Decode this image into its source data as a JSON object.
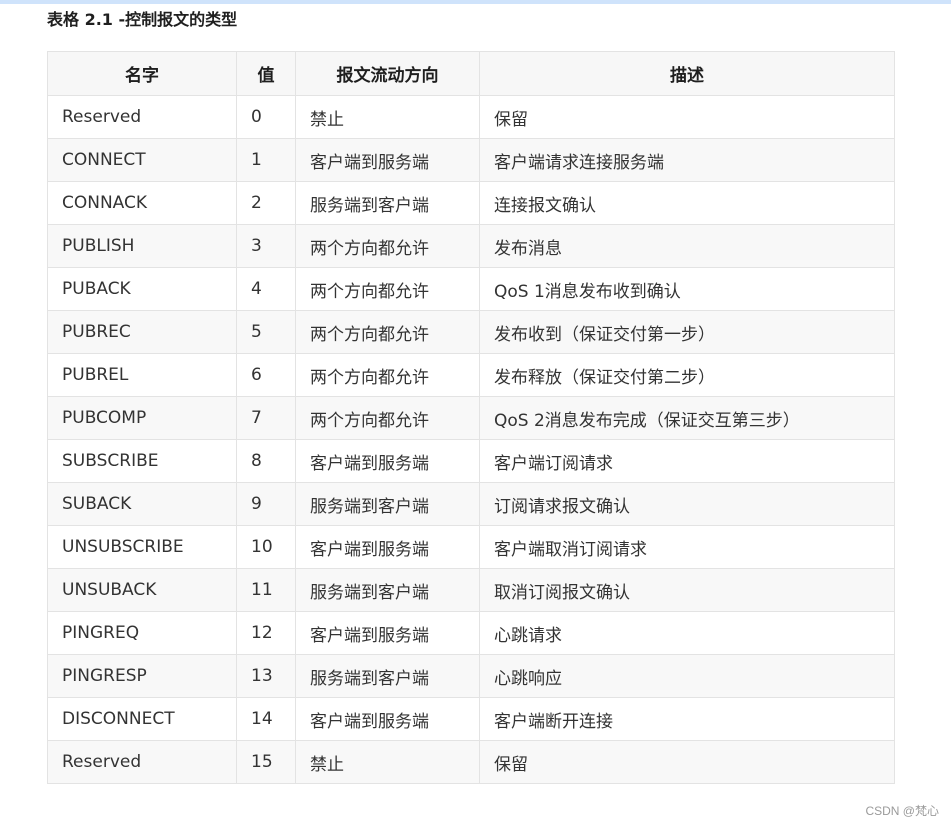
{
  "caption": "表格 2.1 -控制报文的类型",
  "table": {
    "headers": [
      "名字",
      "值",
      "报文流动方向",
      "描述"
    ],
    "rows": [
      [
        "Reserved",
        "0",
        "禁止",
        "保留"
      ],
      [
        "CONNECT",
        "1",
        "客户端到服务端",
        "客户端请求连接服务端"
      ],
      [
        "CONNACK",
        "2",
        "服务端到客户端",
        "连接报文确认"
      ],
      [
        "PUBLISH",
        "3",
        "两个方向都允许",
        "发布消息"
      ],
      [
        "PUBACK",
        "4",
        "两个方向都允许",
        "QoS 1消息发布收到确认"
      ],
      [
        "PUBREC",
        "5",
        "两个方向都允许",
        "发布收到（保证交付第一步）"
      ],
      [
        "PUBREL",
        "6",
        "两个方向都允许",
        "发布释放（保证交付第二步）"
      ],
      [
        "PUBCOMP",
        "7",
        "两个方向都允许",
        "QoS 2消息发布完成（保证交互第三步）"
      ],
      [
        "SUBSCRIBE",
        "8",
        "客户端到服务端",
        "客户端订阅请求"
      ],
      [
        "SUBACK",
        "9",
        "服务端到客户端",
        "订阅请求报文确认"
      ],
      [
        "UNSUBSCRIBE",
        "10",
        "客户端到服务端",
        "客户端取消订阅请求"
      ],
      [
        "UNSUBACK",
        "11",
        "服务端到客户端",
        "取消订阅报文确认"
      ],
      [
        "PINGREQ",
        "12",
        "客户端到服务端",
        "心跳请求"
      ],
      [
        "PINGRESP",
        "13",
        "服务端到客户端",
        "心跳响应"
      ],
      [
        "DISCONNECT",
        "14",
        "客户端到服务端",
        "客户端断开连接"
      ],
      [
        "Reserved",
        "15",
        "禁止",
        "保留"
      ]
    ]
  },
  "watermark": "CSDN @梵心"
}
